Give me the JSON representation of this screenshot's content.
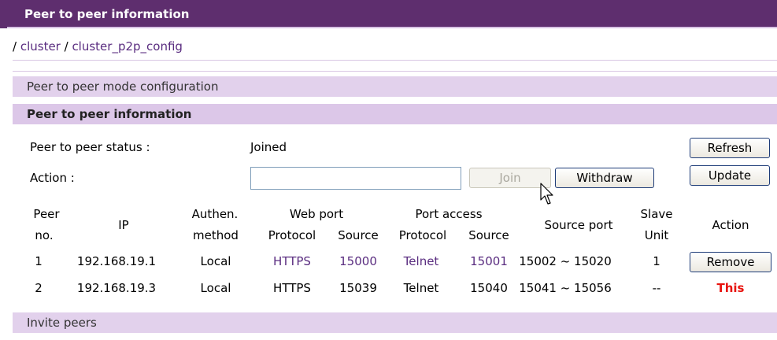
{
  "header": {
    "title": "Peer to peer information"
  },
  "breadcrumb": {
    "sep1": "/ ",
    "part1": "cluster",
    "sep2": " / ",
    "part2": "cluster_p2p_config"
  },
  "sections": {
    "mode_config": "Peer to peer mode configuration",
    "info": "Peer to peer information",
    "invite": "Invite peers"
  },
  "status": {
    "label": "Peer to peer status :",
    "value": "Joined",
    "action_label": "Action :",
    "action_value": ""
  },
  "buttons": {
    "refresh": "Refresh",
    "update": "Update",
    "join": "Join",
    "withdraw": "Withdraw"
  },
  "table": {
    "headers": {
      "peer_line1": "Peer",
      "peer_line2": "no.",
      "ip": "IP",
      "auth_line1": "Authen.",
      "auth_line2": "method",
      "web_port": "Web port",
      "port_access": "Port access",
      "protocol": "Protocol",
      "source": "Source",
      "source_port": "Source port",
      "slave_line1": "Slave",
      "slave_line2": "Unit",
      "action": "Action"
    },
    "rows": [
      {
        "no": "1",
        "ip": "192.168.19.1",
        "auth": "Local",
        "web_protocol": "HTTPS",
        "web_source": "15000",
        "pa_protocol": "Telnet",
        "pa_source": "15001",
        "source_port": "15002 ~ 15020",
        "slave": "1",
        "action": "Remove"
      },
      {
        "no": "2",
        "ip": "192.168.19.3",
        "auth": "Local",
        "web_protocol": "HTTPS",
        "web_source": "15039",
        "pa_protocol": "Telnet",
        "pa_source": "15040",
        "source_port": "15041 ~ 15056",
        "slave": "--",
        "action": "This"
      }
    ]
  },
  "colors": {
    "header_bg": "#5e2e6e",
    "section_bg": "#e2d1ec",
    "link": "#5a2d80",
    "this_label": "#e8130e"
  },
  "icons": {
    "cursor": "arrow-cursor-icon"
  }
}
